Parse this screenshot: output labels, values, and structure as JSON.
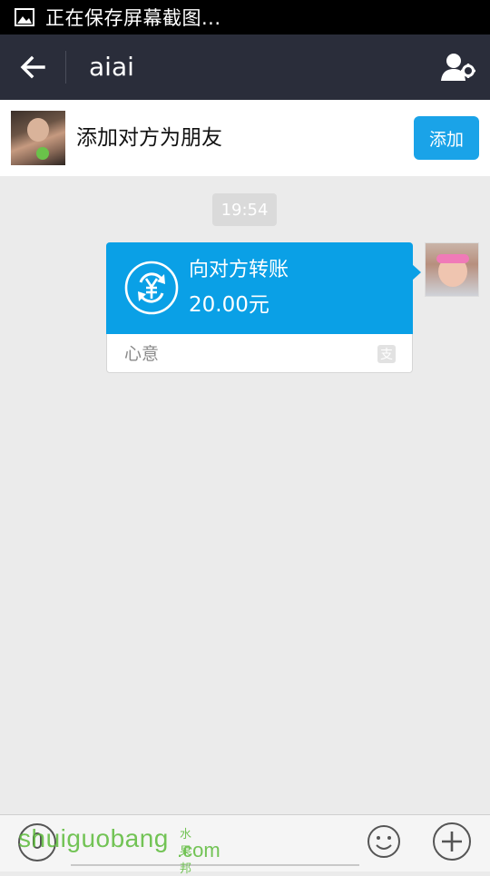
{
  "status_bar": {
    "text": "正在保存屏幕截图..."
  },
  "header": {
    "title": "aiai"
  },
  "add_friend": {
    "prompt": "添加对方为朋友",
    "button_label": "添加"
  },
  "chat": {
    "timestamp": "19:54",
    "transfer": {
      "title": "向对方转账",
      "amount": "20.00元",
      "note": "心意",
      "brand_icon": "支",
      "accent_color": "#0aa0e6"
    }
  },
  "watermark": {
    "main": "shuiguobang",
    "cn": "水果邦",
    "com": ".com"
  },
  "icons": {
    "status": "picture-icon",
    "back": "back-arrow-icon",
    "settings": "contact-settings-icon",
    "transfer": "yuan-transfer-icon",
    "voice": "voice-icon",
    "emoji": "emoji-icon",
    "plus": "plus-icon"
  }
}
